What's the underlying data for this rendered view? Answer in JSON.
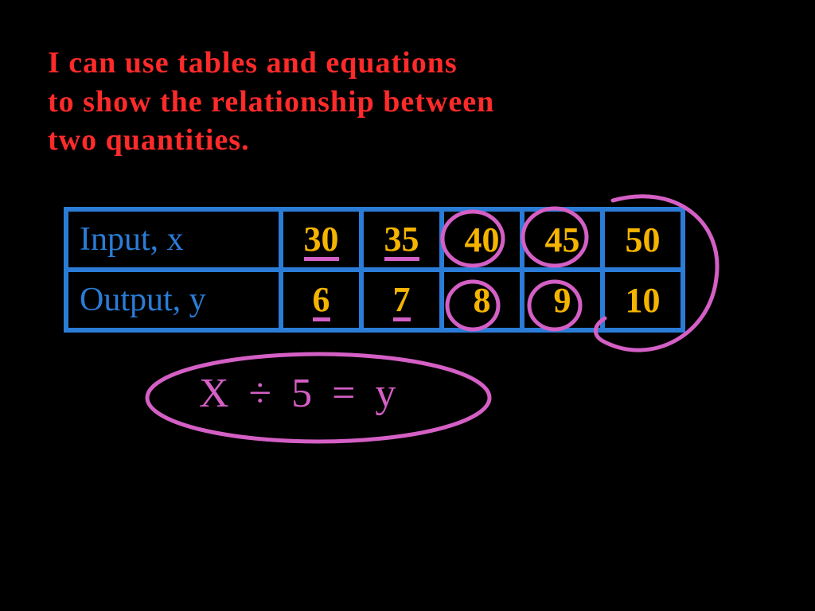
{
  "title": {
    "line1": "I can use tables and equations",
    "line2": "to show the relationship between",
    "line3": "two quantities."
  },
  "table": {
    "row1": {
      "label": "Input, x",
      "v1": "30",
      "v2": "35",
      "v3": "40",
      "v4": "45",
      "v5": "50"
    },
    "row2": {
      "label": "Output, y",
      "v1": "6",
      "v2": "7",
      "v3": "8",
      "v4": "9",
      "v5": "10"
    }
  },
  "equation": "X ÷ 5 = y",
  "chart_data": {
    "type": "table",
    "columns": [
      "Input, x",
      "Output, y"
    ],
    "rows": [
      [
        30,
        6
      ],
      [
        35,
        7
      ],
      [
        40,
        8
      ],
      [
        45,
        9
      ],
      [
        50,
        10
      ]
    ],
    "relation": "x ÷ 5 = y"
  }
}
